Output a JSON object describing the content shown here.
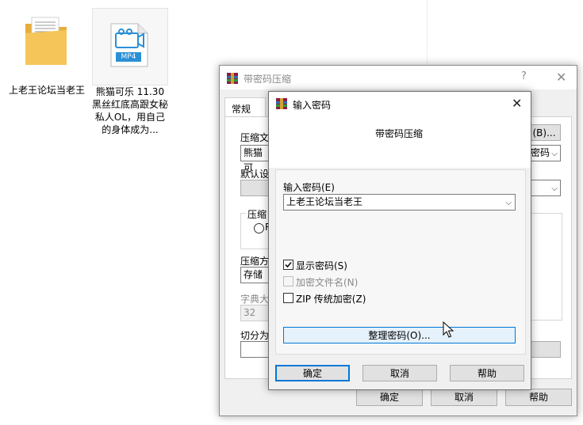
{
  "desktop": {
    "folder_label": "上老王论坛当老王",
    "file_label": "熊猫可乐 11.30 黑丝红底高跟女秘私人OL，用自己的身体成为...",
    "file_badge": "MP4"
  },
  "back_dialog": {
    "title": "带密码压缩",
    "help_glyph": "?",
    "close_glyph": "✕",
    "tab_general": "常规",
    "label_archive": "压缩文",
    "archive_value": "熊猫可",
    "browse_label": "(B)...",
    "format_partial": "密码",
    "label_default": "默认设",
    "group_label": "压缩",
    "radio_partial": "R",
    "label_method": "压缩方",
    "method_value": "存储",
    "label_dict": "字典大",
    "dict_value": "32",
    "label_split": "切分为",
    "ok_label": "确定",
    "cancel_label": "取消",
    "help_label": "帮助"
  },
  "pwd_dialog": {
    "title": "输入密码",
    "close_glyph": "✕",
    "subtitle": "带密码压缩",
    "enter_label": "输入密码(E)",
    "password_value": "上老王论坛当老王",
    "show_pwd": "显示密码(S)",
    "encrypt_names": "加密文件名(N)",
    "zip_legacy": "ZIP 传统加密(Z)",
    "organize": "整理密码(O)...",
    "ok": "确定",
    "cancel": "取消",
    "help": "帮助"
  },
  "colors": {
    "folder": "#f5c55a",
    "file_blue": "#2b8fd6",
    "default_border": "#0078d7"
  }
}
